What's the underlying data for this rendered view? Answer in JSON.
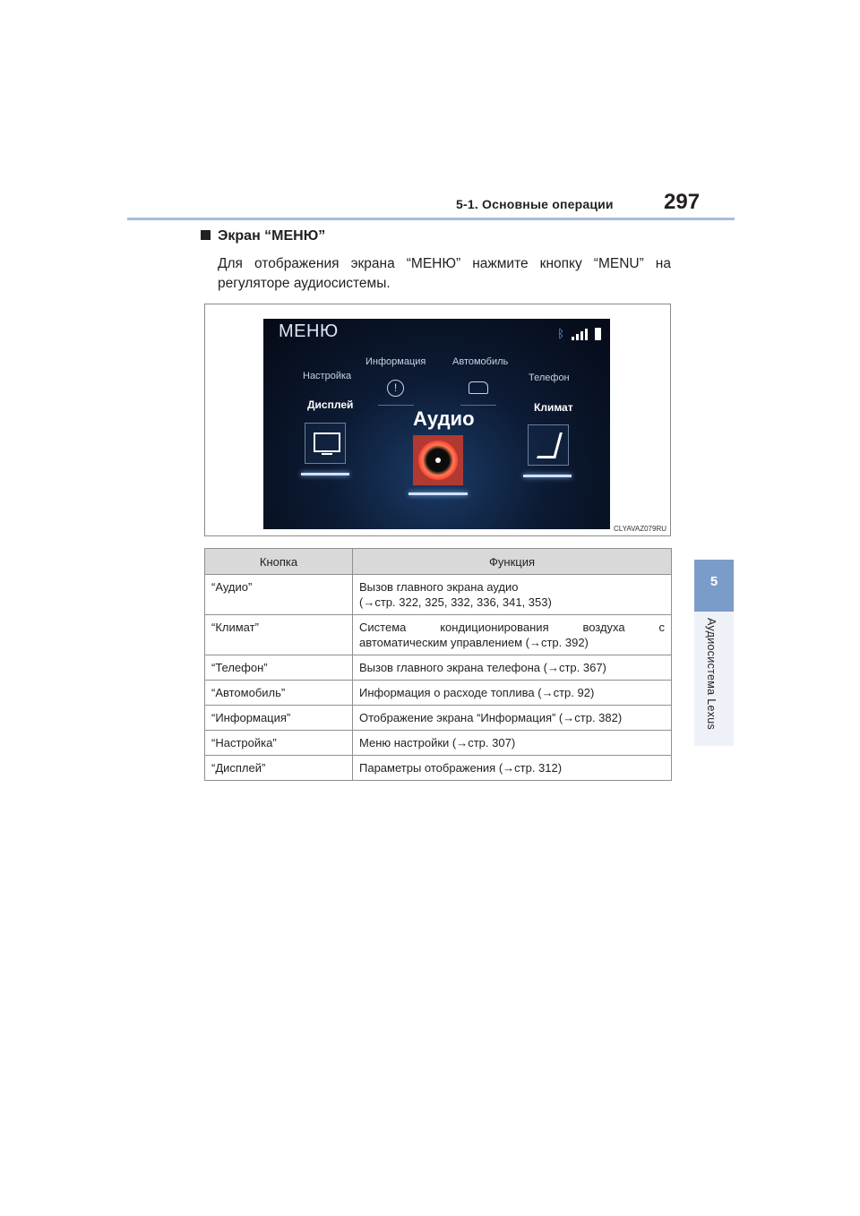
{
  "header": {
    "section": "5-1. Основные операции",
    "page": "297"
  },
  "side_tab": {
    "number": "5",
    "label": "Аудиосистема Lexus"
  },
  "heading": "Экран “МЕНЮ”",
  "intro": "Для отображения экрана “МЕНЮ” нажмите кнопку “MENU” на регуляторе аудиосистемы.",
  "figure": {
    "code": "CLYAVAZ079RU",
    "screen": {
      "title": "МЕНЮ",
      "items": {
        "settings": "Настройка",
        "info": "Информация",
        "vehicle": "Автомобиль",
        "phone": "Телефон",
        "display": "Дисплей",
        "climate": "Климат",
        "audio": "Аудио"
      },
      "icons": [
        "bluetooth-icon",
        "signal-icon",
        "battery-icon",
        "monitor-icon",
        "info-icon",
        "car-icon",
        "seat-climate-icon",
        "disc-icon"
      ],
      "colors": {
        "background": "#0c1a33",
        "accent": "#b03a32",
        "glow": "#cfe3ff"
      }
    }
  },
  "table": {
    "headers": [
      "Кнопка",
      "Функция"
    ],
    "rows": [
      {
        "button": "“Аудио”",
        "function_line1": "Вызов главного экрана аудио",
        "function_line2": "(→стр. 322, 325, 332, 336, 341, 353)"
      },
      {
        "button": "“Климат”",
        "function_line1": "Система кондиционирования воздуха с",
        "function_line2": "автоматическим управлением (→стр. 392)"
      },
      {
        "button": "“Телефон”",
        "function_line1": "Вызов главного экрана телефона (→стр. 367)"
      },
      {
        "button": "“Автомобиль”",
        "function_line1": "Информация о расходе топлива (→стр. 92)"
      },
      {
        "button": "“Информация”",
        "function_line1": "Отображение экрана “Информация” (→стр. 382)"
      },
      {
        "button": "“Настройка”",
        "function_line1": "Меню настройки (→стр. 307)"
      },
      {
        "button": "“Дисплей”",
        "function_line1": "Параметры отображения (→стр. 312)"
      }
    ]
  }
}
